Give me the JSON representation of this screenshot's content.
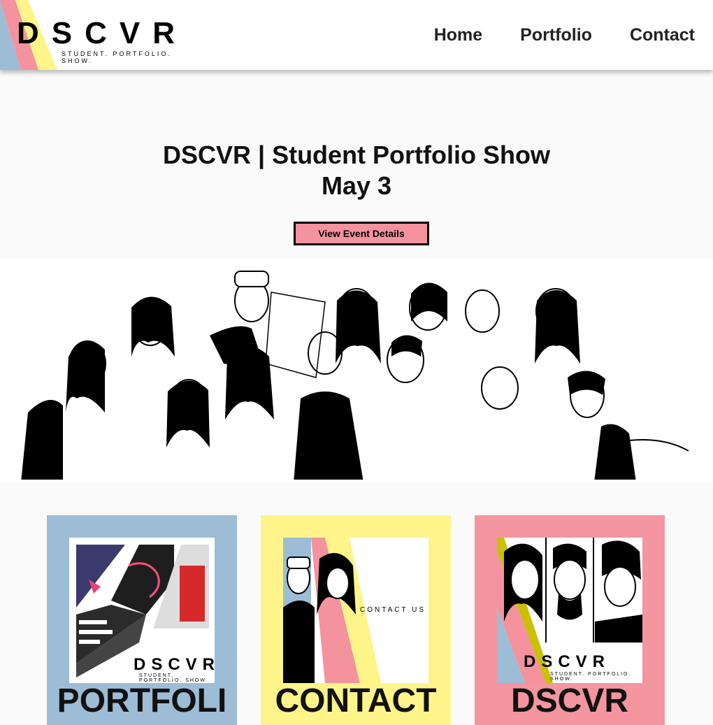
{
  "brand": {
    "name": "DSCVR",
    "tagline": "STUDENT. PORTFOLIO. SHOW."
  },
  "nav": [
    {
      "label": "Home"
    },
    {
      "label": "Portfolio"
    },
    {
      "label": "Contact"
    }
  ],
  "hero": {
    "title_line1": "DSCVR | Student Portfolio Show",
    "title_line2": "May 3",
    "button_label": "View Event Details"
  },
  "cards": [
    {
      "title": "PORTFOLI",
      "bg": "#9dbcd6",
      "thumb_brand": "DSCVR",
      "thumb_tagline": "STUDENT. PORTFOLIO. SHOW."
    },
    {
      "title": "CONTACT",
      "bg": "#fff48a",
      "thumb_text": "CONTACT US"
    },
    {
      "title": "DSCVR",
      "bg": "#f4959f",
      "thumb_brand": "DSCVR",
      "thumb_tagline": "STUDENT. PORTFOLIO. SHOW."
    }
  ],
  "colors": {
    "blue": "#9dbcd6",
    "pink": "#f4929e",
    "yellow": "#fff48a"
  }
}
